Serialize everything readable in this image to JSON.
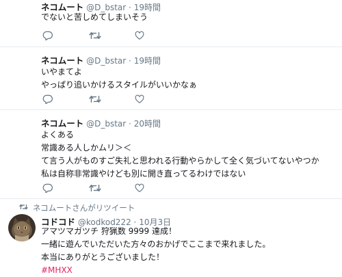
{
  "colors": {
    "text": "#14171a",
    "muted": "#657786",
    "border": "#e6ecf0",
    "hashtag": "#e0245e"
  },
  "icons": {
    "reply": "reply-icon",
    "retweet": "retweet-icon",
    "like": "heart-icon"
  },
  "tweets": [
    {
      "name": "ネコムート",
      "handle": "@D_bstar",
      "dot": "·",
      "time": "19時間",
      "lines": [
        "でないと苦しめてしまいそう"
      ]
    },
    {
      "name": "ネコムート",
      "handle": "@D_bstar",
      "dot": "·",
      "time": "19時間",
      "lines": [
        "いやまてよ",
        "やっぱり追いかけるスタイルがいいかなぁ"
      ]
    },
    {
      "name": "ネコムート",
      "handle": "@D_bstar",
      "dot": "·",
      "time": "20時間",
      "lines": [
        "よくある",
        "常識ある人しかムリ＞＜",
        "て言う人がものすご失礼と思われる行動やらかして全く気づいてないやつか",
        "私は自称非常識やけども別に開き直ってるわけではない"
      ]
    },
    {
      "retweet_context": "ネコムートさんがリツイート",
      "name": "コドコド",
      "handle": "@kodkod222",
      "dot": "·",
      "time": "10月3日",
      "lines": [
        "アマツマガツチ 狩猟数 9999 達成！",
        "一緒に遊んでいただいた方々のおかげでここまで来れました。",
        "本当にありがとうございました！"
      ],
      "hashtag": "#MHXX"
    }
  ]
}
